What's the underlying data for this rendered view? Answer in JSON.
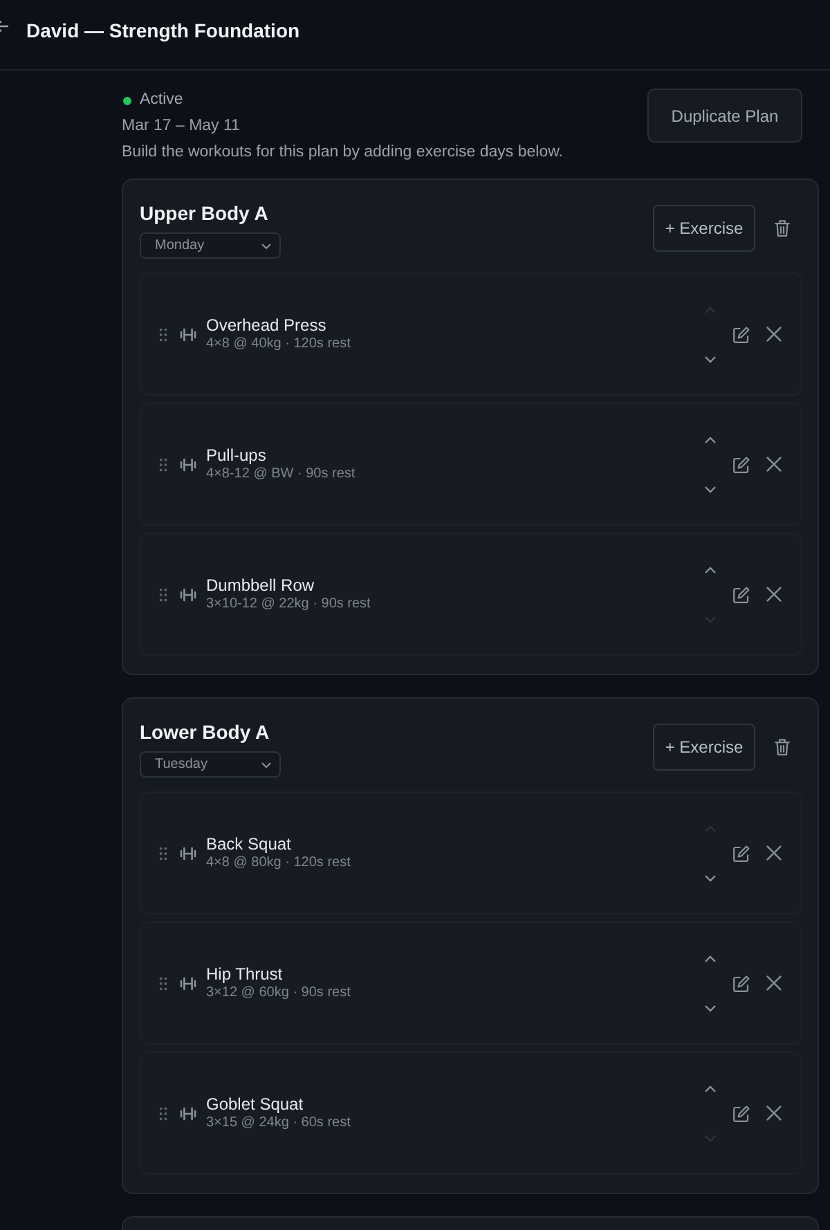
{
  "header": {
    "title": "David — Strength Foundation"
  },
  "plan": {
    "status": {
      "label": "Active",
      "active": true
    },
    "dates": "Mar 17 – May 11",
    "description": "Build the workouts for this plan by adding exercise days below.",
    "duplicate_button": "Duplicate Plan"
  },
  "days": [
    {
      "title": "Upper Body A",
      "weekday": "Monday",
      "add_button": "+ Exercise",
      "exercises": [
        {
          "name": "Overhead Press",
          "details": "4×8 @ 40kg · 120s rest",
          "up_disabled": true,
          "down_disabled": false
        },
        {
          "name": "Pull-ups",
          "details": "4×8-12 @ BW · 90s rest",
          "up_disabled": false,
          "down_disabled": false
        },
        {
          "name": "Dumbbell Row",
          "details": "3×10-12 @ 22kg · 90s rest",
          "up_disabled": false,
          "down_disabled": true
        }
      ]
    },
    {
      "title": "Lower Body A",
      "weekday": "Tuesday",
      "add_button": "+ Exercise",
      "exercises": [
        {
          "name": "Back Squat",
          "details": "4×8 @ 80kg · 120s rest",
          "up_disabled": true,
          "down_disabled": false
        },
        {
          "name": "Hip Thrust",
          "details": "3×12 @ 60kg · 90s rest",
          "up_disabled": false,
          "down_disabled": false
        },
        {
          "name": "Goblet Squat",
          "details": "3×15 @ 24kg · 60s rest",
          "up_disabled": false,
          "down_disabled": true
        }
      ]
    }
  ]
}
